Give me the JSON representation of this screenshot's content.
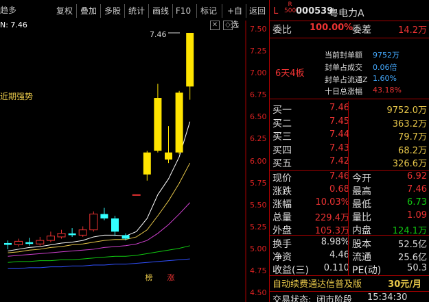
{
  "toolbar": {
    "left_text": "趋多",
    "buttons": [
      "复权",
      "叠加",
      "多股",
      "统计",
      "画线",
      "F10",
      "标记",
      "+自选",
      "返回"
    ]
  },
  "chart": {
    "indicator_label": "N: 7.46",
    "trend_label": "近期强势",
    "peak_label": "7.46",
    "close_symbol": "✕",
    "nav_symbol": "◇",
    "price_axis": [
      "7.50",
      "7.25",
      "7.00",
      "6.75",
      "6.50",
      "6.25",
      "6.00",
      "5.75",
      "5.50",
      "5.25",
      "5.00",
      "4.75",
      "4.50"
    ],
    "badges": [
      {
        "text": "榜",
        "color": "#e8c84a"
      },
      {
        "text": "涨",
        "color": "#e33"
      }
    ],
    "candles": [
      {
        "o": 5.07,
        "c": 5.05,
        "h": 5.1,
        "l": 5.0
      },
      {
        "o": 5.05,
        "c": 5.09,
        "h": 5.12,
        "l": 5.03
      },
      {
        "o": 5.08,
        "c": 5.06,
        "h": 5.13,
        "l": 5.04
      },
      {
        "o": 5.06,
        "c": 5.1,
        "h": 5.14,
        "l": 5.04
      },
      {
        "o": 5.1,
        "c": 5.15,
        "h": 5.2,
        "l": 5.08
      },
      {
        "o": 5.14,
        "c": 5.18,
        "h": 5.22,
        "l": 5.12
      },
      {
        "o": 5.18,
        "c": 5.16,
        "h": 5.24,
        "l": 5.14
      },
      {
        "o": 5.16,
        "c": 5.22,
        "h": 5.26,
        "l": 5.14
      },
      {
        "o": 5.22,
        "c": 5.4,
        "h": 5.43,
        "l": 5.2
      },
      {
        "o": 5.4,
        "c": 5.35,
        "h": 5.47,
        "l": 5.33
      },
      {
        "o": 5.35,
        "c": 5.2,
        "h": 5.38,
        "l": 5.15
      },
      {
        "o": 5.16,
        "c": 5.12,
        "h": 5.18,
        "l": 5.1
      },
      {
        "o": 5.62,
        "c": 5.62,
        "h": 5.62,
        "l": 5.62
      },
      {
        "o": 5.85,
        "c": 6.1,
        "h": 6.12,
        "l": 5.78
      },
      {
        "o": 6.12,
        "c": 6.72,
        "h": 6.88,
        "l": 6.1
      },
      {
        "o": 6.02,
        "c": 6.1,
        "h": 6.4,
        "l": 5.98
      },
      {
        "o": 6.1,
        "c": 6.78,
        "h": 6.8,
        "l": 6.08
      },
      {
        "o": 6.85,
        "c": 7.46,
        "h": 7.46,
        "l": 6.7
      }
    ],
    "ma": [
      {
        "color": "#ffffff",
        "values": [
          4.98,
          5.0,
          5.02,
          5.03,
          5.05,
          5.07,
          5.08,
          5.1,
          5.14,
          5.16,
          5.16,
          5.15,
          5.2,
          5.35,
          5.62,
          5.8,
          6.05,
          6.45
        ]
      },
      {
        "color": "#e8c84a",
        "values": [
          4.96,
          4.97,
          4.99,
          5.0,
          5.02,
          5.03,
          5.05,
          5.06,
          5.08,
          5.1,
          5.11,
          5.11,
          5.14,
          5.22,
          5.38,
          5.55,
          5.75,
          5.98
        ]
      },
      {
        "color": "#d040d0",
        "values": [
          4.92,
          4.93,
          4.94,
          4.95,
          4.96,
          4.97,
          4.98,
          4.99,
          5.0,
          5.02,
          5.03,
          5.04,
          5.06,
          5.1,
          5.18,
          5.28,
          5.4,
          5.53
        ]
      },
      {
        "color": "#1c1",
        "values": [
          4.85,
          4.86,
          4.86,
          4.87,
          4.87,
          4.88,
          4.88,
          4.89,
          4.9,
          4.91,
          4.92,
          4.92,
          4.93,
          4.95,
          4.97,
          4.99,
          5.01,
          5.04
        ]
      },
      {
        "color": "#3050ff",
        "values": [
          4.78,
          4.78,
          4.79,
          4.79,
          4.8,
          4.8,
          4.81,
          4.81,
          4.82,
          4.82,
          4.83,
          4.83,
          4.84,
          4.85,
          4.86,
          4.87,
          4.88,
          4.89
        ]
      }
    ],
    "ymin": 4.4,
    "ymax": 7.6
  },
  "panel": {
    "header": {
      "L": "L",
      "R": "R",
      "num": "500",
      "code": "000539",
      "name": "粤电力A"
    },
    "weibi": {
      "label1": "委比",
      "value1": "100.00%",
      "label2": "委差",
      "value2": "14.2万"
    },
    "seal_info": {
      "title": "6天4板",
      "rows": [
        {
          "label": "当前封单额",
          "value": "9752万"
        },
        {
          "label": "封单占成交",
          "value": "0.06倍"
        },
        {
          "label": "封单占流通Z",
          "value": "1.60%"
        },
        {
          "label": "十日总涨幅",
          "value": "43.18%"
        }
      ]
    },
    "orders": [
      {
        "label": "买一",
        "price": "7.46",
        "vol": "9752.0万"
      },
      {
        "label": "买二",
        "price": "7.45",
        "vol": "363.2万"
      },
      {
        "label": "买三",
        "price": "7.44",
        "vol": "79.7万"
      },
      {
        "label": "买四",
        "price": "7.43",
        "vol": "68.2万"
      },
      {
        "label": "买五",
        "price": "7.42",
        "vol": "326.6万"
      }
    ],
    "quote": [
      {
        "l1": "现价",
        "v1": "7.46",
        "c1": "red",
        "l2": "今开",
        "v2": "6.92",
        "c2": "red"
      },
      {
        "l1": "涨跌",
        "v1": "0.68",
        "c1": "red",
        "l2": "最高",
        "v2": "7.46",
        "c2": "red"
      },
      {
        "l1": "涨幅",
        "v1": "10.03%",
        "c1": "red",
        "l2": "最低",
        "v2": "6.73",
        "c2": "green"
      },
      {
        "l1": "总量",
        "v1": "229.4万",
        "c1": "red",
        "l2": "量比",
        "v2": "1.09",
        "c2": "red"
      },
      {
        "l1": "外盘",
        "v1": "105.3万",
        "c1": "red",
        "l2": "内盘",
        "v2": "124.1万",
        "c2": "green"
      }
    ],
    "fund": [
      {
        "l1": "换手",
        "v1": "8.98%",
        "l2": "股本",
        "v2": "52.5亿"
      },
      {
        "l1": "净资",
        "v1": "4.46",
        "l2": "流通",
        "v2": "25.6亿"
      },
      {
        "l1": "收益(三)",
        "v1": "0.110",
        "l2": "PE(动)",
        "v2": "50.3"
      }
    ],
    "ad": {
      "text": "自动续费通达信普及版",
      "price": "30元/月"
    },
    "status": {
      "label": "交易状态:",
      "value": "闭市阶段",
      "time": "15:34:30"
    }
  }
}
